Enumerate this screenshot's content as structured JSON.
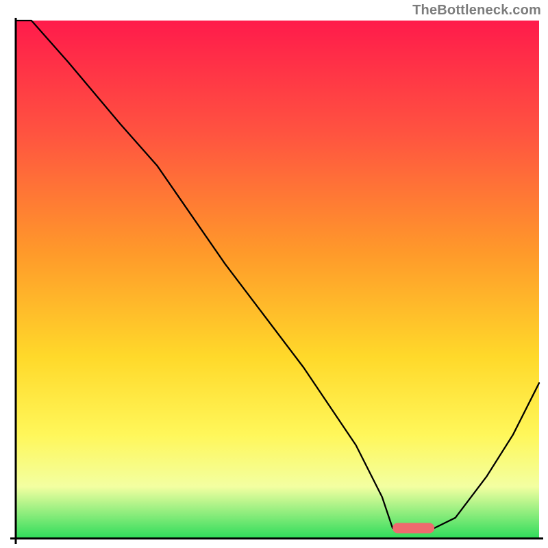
{
  "watermark": "TheBottleneck.com",
  "chart_data": {
    "type": "line",
    "title": "",
    "xlabel": "",
    "ylabel": "",
    "xlim": [
      0,
      100
    ],
    "ylim": [
      0,
      100
    ],
    "grid": false,
    "legend": false,
    "background": {
      "description": "vertical gradient from red through orange/yellow to green at the bottom",
      "stops": [
        {
          "pct": 0,
          "color": "#ff1b4b"
        },
        {
          "pct": 22,
          "color": "#ff5440"
        },
        {
          "pct": 45,
          "color": "#ff9a2a"
        },
        {
          "pct": 65,
          "color": "#ffd92a"
        },
        {
          "pct": 80,
          "color": "#fff75a"
        },
        {
          "pct": 90,
          "color": "#f3ffa1"
        },
        {
          "pct": 100,
          "color": "#2edc5b"
        }
      ]
    },
    "series": [
      {
        "name": "curve",
        "color": "#000000",
        "width": 2.3,
        "x": [
          0,
          3,
          10,
          20,
          27,
          40,
          55,
          65,
          70,
          72,
          77,
          80,
          84,
          90,
          95,
          100
        ],
        "y": [
          100,
          100,
          92,
          80,
          72,
          53,
          33,
          18,
          8,
          2,
          2,
          2,
          4,
          12,
          20,
          30
        ]
      }
    ],
    "marker": {
      "name": "optimum-range",
      "shape": "rounded bar",
      "color": "#ee6b6e",
      "x_start": 72,
      "x_end": 80,
      "y": 1,
      "height": 2
    },
    "axes": {
      "left": {
        "color": "#000000",
        "width": 3
      },
      "bottom": {
        "color": "#000000",
        "width": 3
      }
    }
  }
}
